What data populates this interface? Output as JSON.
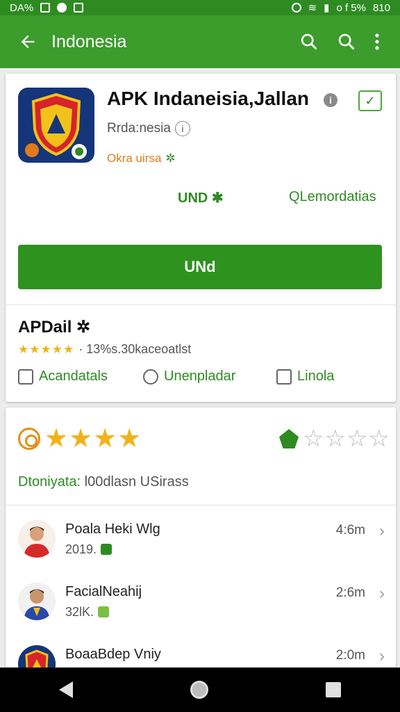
{
  "status_bar": {
    "left_text": "DA%",
    "right_text": "o f 5%",
    "time": "810"
  },
  "app_bar": {
    "title": "Indonesia"
  },
  "app": {
    "title": "APK Indaneisia,Jallan",
    "developer": "Rrda:nesia",
    "badge": "Okra uirsa",
    "link_und": "UND",
    "link_recommend": "Lemordatias",
    "install_label": "UNd"
  },
  "rating_section": {
    "title": "APDail",
    "stars": "★★★★★",
    "summary": "13%s.30kaceoatlst",
    "chips": [
      "Acandatals",
      "Unenpladar",
      "Linola"
    ]
  },
  "reviews_section": {
    "summary_label": "Dtoniyata:",
    "summary_value": "l00dlasn USirass",
    "star_filled": "★★★★",
    "star_empty": "☆☆☆☆",
    "reviews": [
      {
        "name": "Poala Heki Wlg",
        "sub": "2019.",
        "time": "4:6m"
      },
      {
        "name": "FacialNeahij",
        "sub": "32lK.",
        "time": "2:6m"
      },
      {
        "name": "BoaaBdep Vniy",
        "sub": "",
        "time": "2:0m"
      }
    ]
  },
  "colors": {
    "primary": "#3c9c2c",
    "status": "#2e8b22",
    "install": "#2e921f",
    "accent_star": "#f2b21a",
    "badge_orange": "#e07a1a"
  }
}
